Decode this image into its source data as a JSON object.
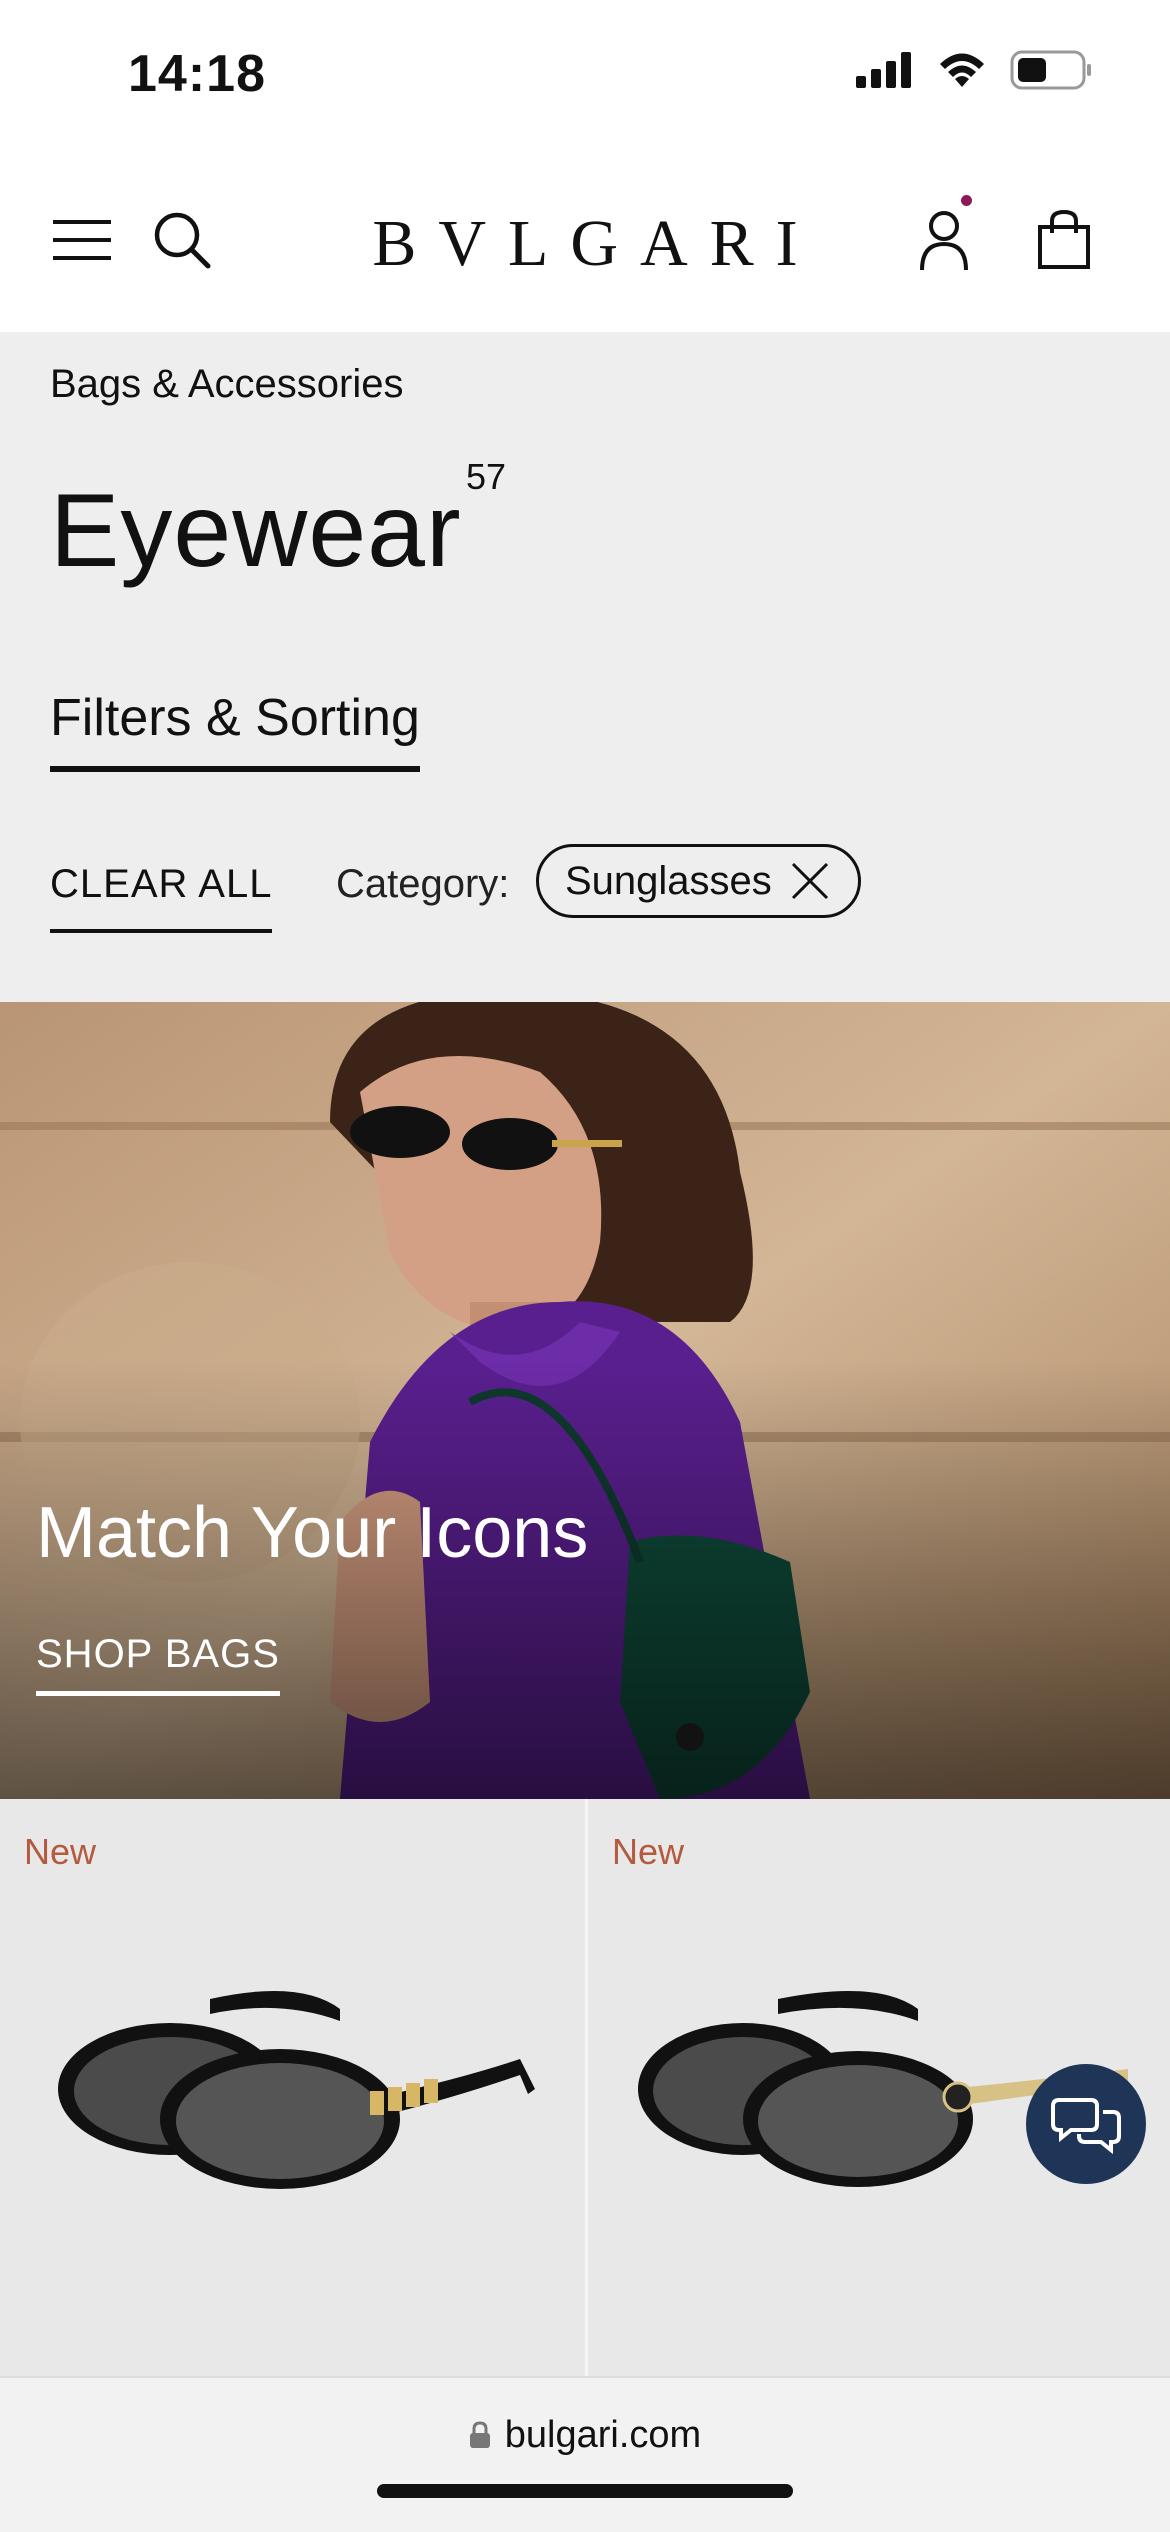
{
  "status": {
    "time": "14:18"
  },
  "header": {
    "logo": "BVLGARI"
  },
  "page": {
    "breadcrumb": "Bags & Accessories",
    "title": "Eyewear",
    "count": "57",
    "filters_label": "Filters & Sorting",
    "clear_all": "CLEAR ALL",
    "category_label": "Category:",
    "category_chip": "Sunglasses"
  },
  "banner": {
    "headline": "Match Your Icons",
    "cta": "SHOP BAGS"
  },
  "products": [
    {
      "badge": "New"
    },
    {
      "badge": "New"
    }
  ],
  "browser": {
    "url": "bulgari.com"
  },
  "colors": {
    "accent_dot": "#8a1b56",
    "badge": "#b45a3d",
    "chat": "#1f3558"
  }
}
